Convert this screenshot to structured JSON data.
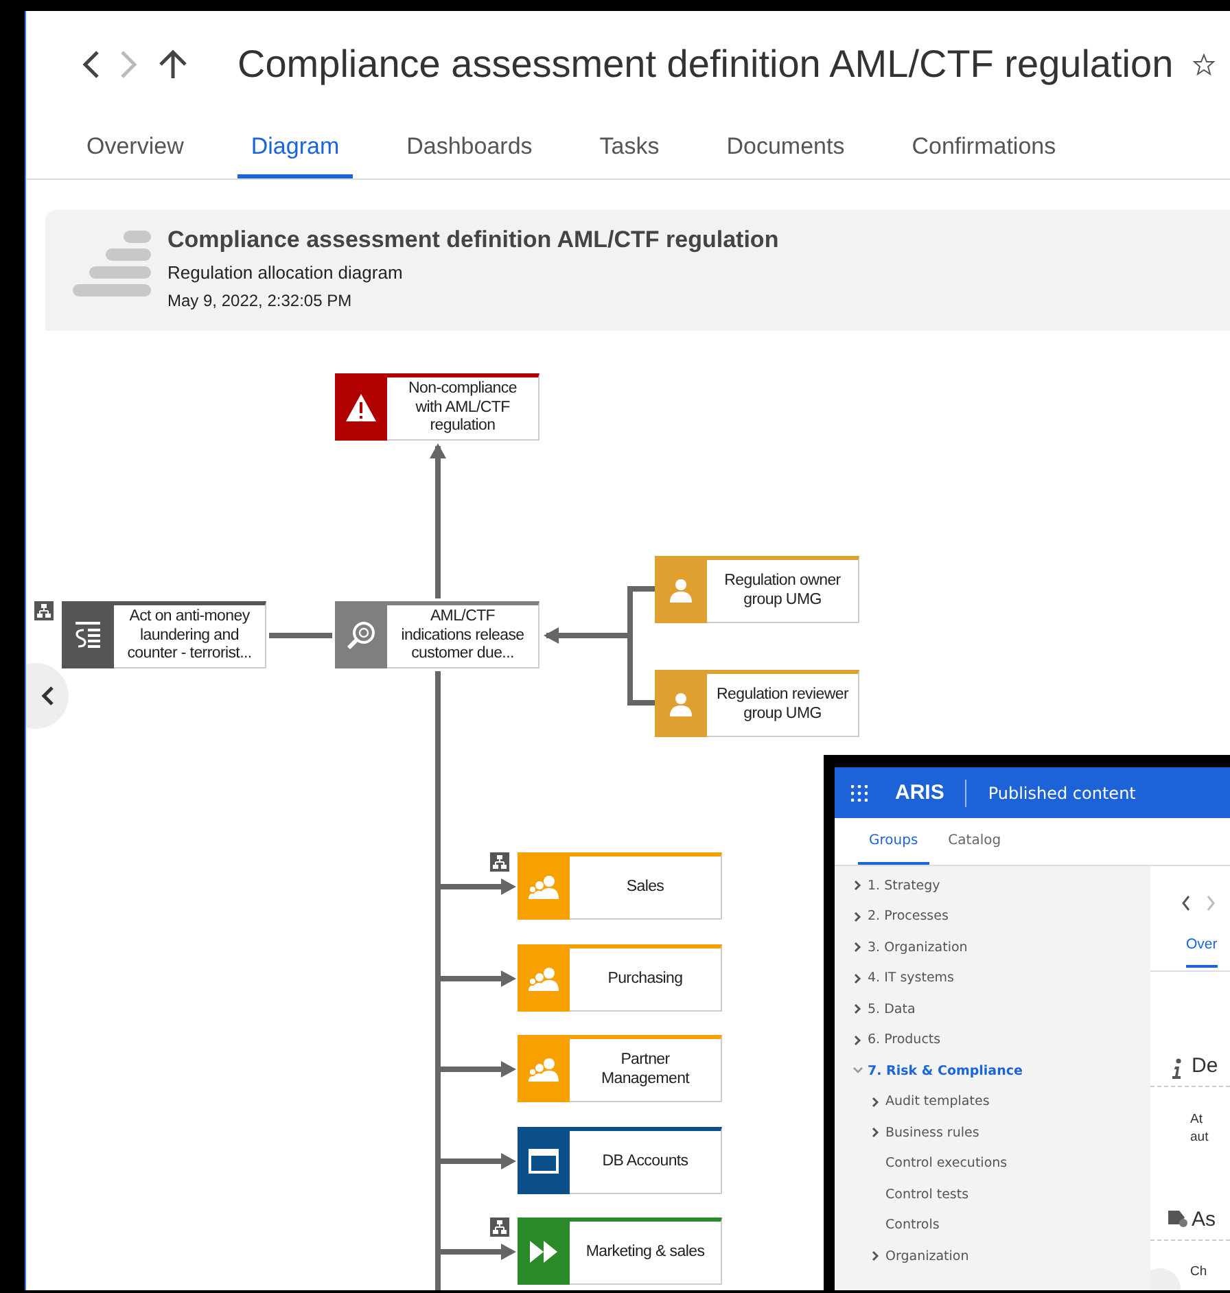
{
  "title": "Compliance assessment definition AML/CTF regulation",
  "tabs": [
    {
      "label": "Overview",
      "selected": false
    },
    {
      "label": "Diagram",
      "selected": true
    },
    {
      "label": "Dashboards",
      "selected": false
    },
    {
      "label": "Tasks",
      "selected": false
    },
    {
      "label": "Documents",
      "selected": false
    },
    {
      "label": "Confirmations",
      "selected": false
    }
  ],
  "model": {
    "title": "Compliance assessment definition AML/CTF regulation",
    "type": "Regulation allocation diagram",
    "date": "May 9, 2022, 2:32:05 PM"
  },
  "diagram": {
    "nodes": [
      {
        "kind": "risk",
        "label": "Non-compliance with AML/CTF regulation",
        "has_assignment": false
      },
      {
        "kind": "regulation",
        "label": "Act on anti-money laundering and counter - terrorist...",
        "has_assignment": true
      },
      {
        "kind": "requirement",
        "label": "AML/CTF indications release customer due...",
        "has_assignment": false
      },
      {
        "kind": "role",
        "label": "Regulation owner group UMG",
        "has_assignment": false
      },
      {
        "kind": "role",
        "label": "Regulation reviewer group UMG",
        "has_assignment": false
      },
      {
        "kind": "org_unit",
        "label": "Sales",
        "has_assignment": true
      },
      {
        "kind": "org_unit",
        "label": "Purchasing",
        "has_assignment": false
      },
      {
        "kind": "org_unit",
        "label": "Partner Management",
        "has_assignment": false
      },
      {
        "kind": "application",
        "label": "DB Accounts",
        "has_assignment": false
      },
      {
        "kind": "process",
        "label": "Marketing & sales",
        "has_assignment": true
      }
    ]
  },
  "inset": {
    "app_name": "ARIS",
    "section": "Published content",
    "tabs": [
      {
        "label": "Groups",
        "selected": true
      },
      {
        "label": "Catalog",
        "selected": false
      }
    ],
    "tree": [
      {
        "label": "1. Strategy",
        "has_children": true,
        "expanded": false,
        "selected": false
      },
      {
        "label": "2. Processes",
        "has_children": true,
        "expanded": false,
        "selected": false
      },
      {
        "label": "3. Organization",
        "has_children": true,
        "expanded": false,
        "selected": false
      },
      {
        "label": "4. IT systems",
        "has_children": true,
        "expanded": false,
        "selected": false
      },
      {
        "label": "5. Data",
        "has_children": true,
        "expanded": false,
        "selected": false
      },
      {
        "label": "6. Products",
        "has_children": true,
        "expanded": false,
        "selected": false
      },
      {
        "label": "7. Risk & Compliance",
        "has_children": true,
        "expanded": true,
        "selected": true,
        "children": [
          {
            "label": "Audit templates",
            "has_children": true,
            "expanded": false,
            "selected": false
          },
          {
            "label": "Business rules",
            "has_children": true,
            "expanded": false,
            "selected": false
          },
          {
            "label": "Control executions",
            "has_children": false,
            "expanded": false,
            "selected": false
          },
          {
            "label": "Control tests",
            "has_children": false,
            "expanded": false,
            "selected": false
          },
          {
            "label": "Controls",
            "has_children": false,
            "expanded": false,
            "selected": false
          },
          {
            "label": "Organization",
            "has_children": true,
            "expanded": false,
            "selected": false
          }
        ]
      }
    ],
    "detail": {
      "tab": "Over",
      "section_1": "De",
      "text_1": [
        "At",
        "aut"
      ],
      "section_2": "As",
      "text_2": "Ch"
    }
  }
}
